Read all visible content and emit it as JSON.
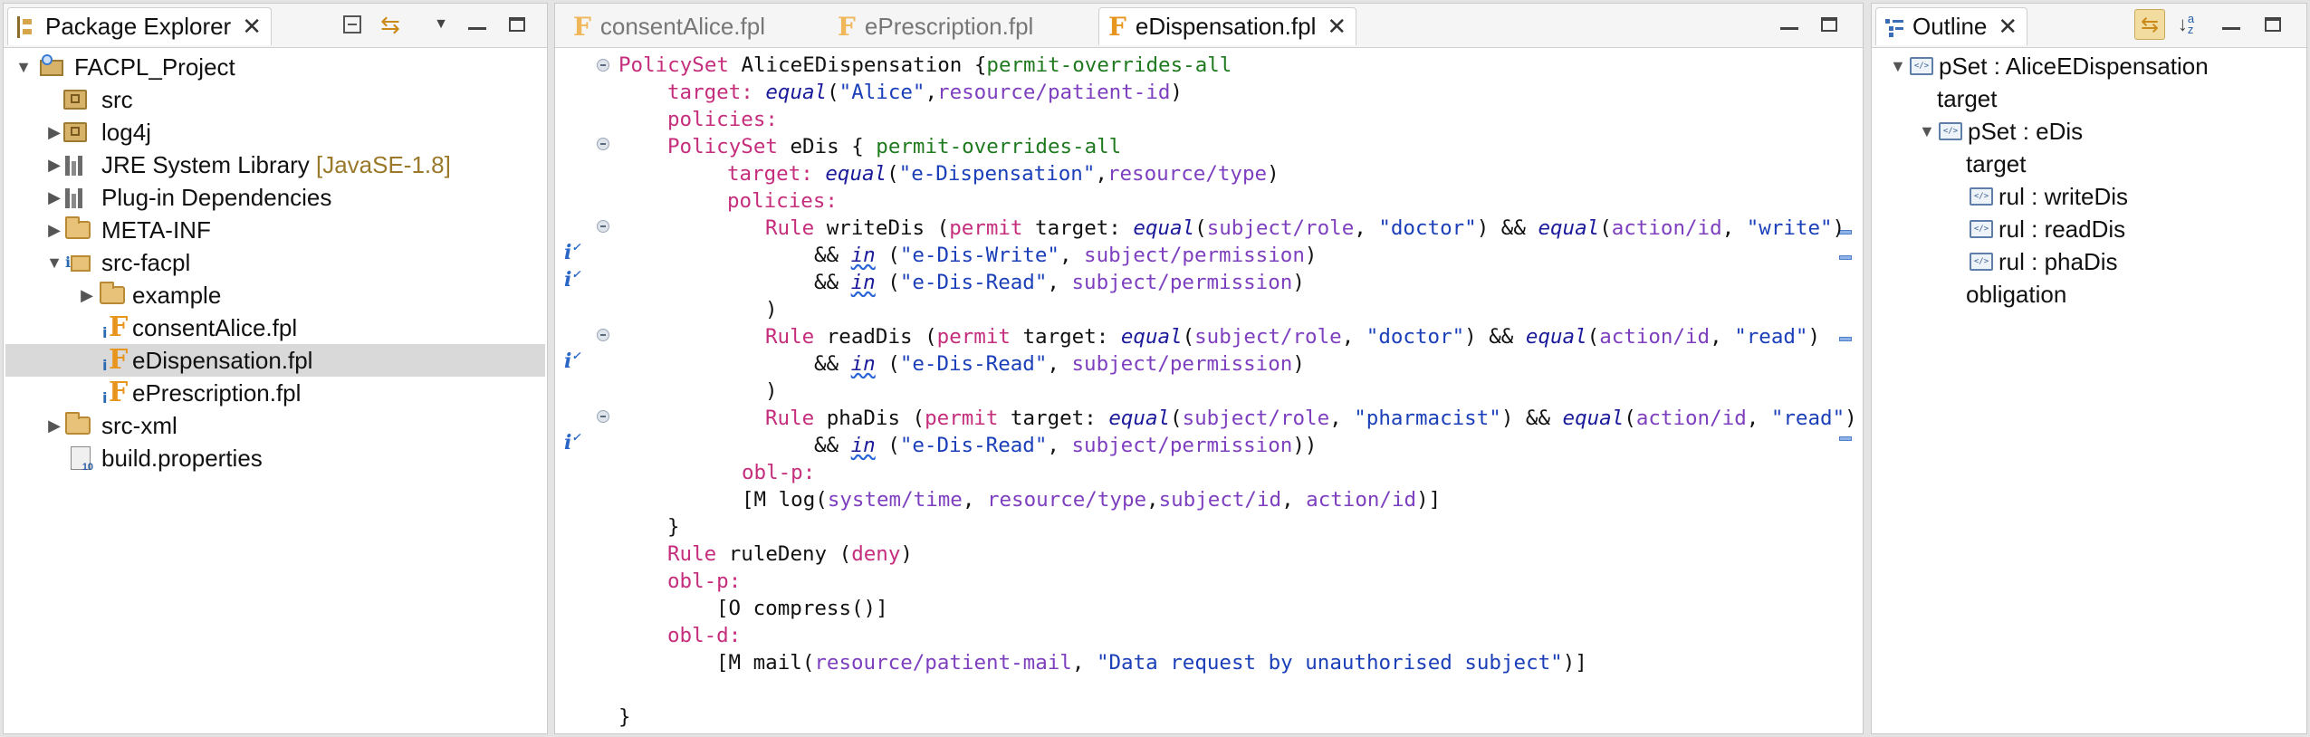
{
  "package_explorer": {
    "title": "Package Explorer",
    "tree": [
      {
        "label": "FACPL_Project",
        "decoration": "",
        "icon": "project-icon",
        "expanded": true
      },
      {
        "label": "src",
        "decoration": "",
        "icon": "package-folder-icon"
      },
      {
        "label": "log4j",
        "decoration": "",
        "icon": "package-folder-icon",
        "expanded": false
      },
      {
        "label": "JRE System Library",
        "decoration": "[JavaSE-1.8]",
        "icon": "library-icon",
        "expanded": false
      },
      {
        "label": "Plug-in Dependencies",
        "decoration": "",
        "icon": "library-icon",
        "expanded": false
      },
      {
        "label": "META-INF",
        "decoration": "",
        "icon": "folder-icon",
        "expanded": false
      },
      {
        "label": "src-facpl",
        "decoration": "",
        "icon": "source-package-icon",
        "expanded": true
      },
      {
        "label": "example",
        "decoration": "",
        "icon": "folder-icon",
        "expanded": false
      },
      {
        "label": "consentAlice.fpl",
        "decoration": "",
        "icon": "fpl-file-icon"
      },
      {
        "label": "eDispensation.fpl",
        "decoration": "",
        "icon": "fpl-file-icon",
        "selected": true
      },
      {
        "label": "ePrescription.fpl",
        "decoration": "",
        "icon": "fpl-file-icon"
      },
      {
        "label": "src-xml",
        "decoration": "",
        "icon": "folder-icon",
        "expanded": false
      },
      {
        "label": "build.properties",
        "decoration": "",
        "icon": "properties-file-icon"
      }
    ]
  },
  "editor": {
    "tabs": [
      {
        "label": "consentAlice.fpl",
        "active": false
      },
      {
        "label": "ePrescription.fpl",
        "active": false
      },
      {
        "label": "eDispensation.fpl",
        "active": true
      }
    ],
    "code": {
      "l1": {
        "a": "PolicySet",
        "b": " AliceEDispensation {",
        "c": "permit-overrides-all"
      },
      "l2": {
        "a": "target:",
        "b": " ",
        "c": "equal",
        "d": "(",
        "e": "\"Alice\"",
        "f": ",",
        "g": "resource/patient-id",
        "h": ")"
      },
      "l3": {
        "a": "policies:"
      },
      "l4": {
        "a": "PolicySet",
        "b": " eDis { ",
        "c": "permit-overrides-all"
      },
      "l5": {
        "a": "target:",
        "b": " ",
        "c": "equal",
        "d": "(",
        "e": "\"e-Dispensation\"",
        "f": ",",
        "g": "resource/type",
        "h": ")"
      },
      "l6": {
        "a": "policies:"
      },
      "l7": {
        "a": "Rule",
        "b": " writeDis (",
        "c": "permit",
        "d": " target: ",
        "e": "equal",
        "f": "(",
        "g": "subject/role",
        "h": ", ",
        "i": "\"doctor\"",
        "j": ") && ",
        "k": "equal",
        "l": "(",
        "m": "action/id",
        "n": ", ",
        "o": "\"write\"",
        "p": ")"
      },
      "l8": {
        "a": "&& ",
        "b": "in",
        "c": " (",
        "d": "\"e-Dis-Write\"",
        "e": ", ",
        "f": "subject/permission",
        "g": ")"
      },
      "l9": {
        "a": "&& ",
        "b": "in",
        "c": " (",
        "d": "\"e-Dis-Read\"",
        "e": ", ",
        "f": "subject/permission",
        "g": ")"
      },
      "l10": {
        "a": ")"
      },
      "l11": {
        "a": "Rule",
        "b": " readDis (",
        "c": "permit",
        "d": " target: ",
        "e": "equal",
        "f": "(",
        "g": "subject/role",
        "h": ", ",
        "i": "\"doctor\"",
        "j": ") && ",
        "k": "equal",
        "l": "(",
        "m": "action/id",
        "n": ", ",
        "o": "\"read\"",
        "p": ")"
      },
      "l12": {
        "a": "&& ",
        "b": "in",
        "c": " (",
        "d": "\"e-Dis-Read\"",
        "e": ", ",
        "f": "subject/permission",
        "g": ")"
      },
      "l13": {
        "a": ")"
      },
      "l14": {
        "a": "Rule",
        "b": " phaDis (",
        "c": "permit",
        "d": " target: ",
        "e": "equal",
        "f": "(",
        "g": "subject/role",
        "h": ", ",
        "i": "\"pharmacist\"",
        "j": ") && ",
        "k": "equal",
        "l": "(",
        "m": "action/id",
        "n": ", ",
        "o": "\"read\"",
        "p": ")"
      },
      "l15": {
        "a": "&& ",
        "b": "in",
        "c": " (",
        "d": "\"e-Dis-Read\"",
        "e": ", ",
        "f": "subject/permission",
        "g": "))"
      },
      "l16": {
        "a": "obl-p:"
      },
      "l17": {
        "a": "[M log(",
        "b": "system/time",
        "c": ", ",
        "d": "resource/type",
        "e": ",",
        "f": "subject/id",
        "g": ", ",
        "h": "action/id",
        "i": ")]"
      },
      "l18": {
        "a": "}"
      },
      "l19": {
        "a": "Rule",
        "b": " ruleDeny (",
        "c": "deny",
        "d": ")"
      },
      "l20": {
        "a": "obl-p:"
      },
      "l21": {
        "a": "[O compress()]"
      },
      "l22": {
        "a": "obl-d:"
      },
      "l23": {
        "a": "[M mail(",
        "b": "resource/patient-mail",
        "c": ", ",
        "d": "\"Data request by unauthorised subject\"",
        "e": ")]"
      },
      "l24": {
        "a": "}"
      }
    }
  },
  "outline": {
    "title": "Outline",
    "items": [
      {
        "label": "pSet : AliceEDispensation",
        "icon": "policy-set-icon"
      },
      {
        "label": "target"
      },
      {
        "label": "pSet : eDis",
        "icon": "policy-set-icon"
      },
      {
        "label": "target"
      },
      {
        "label": "rul : writeDis",
        "icon": "rule-icon"
      },
      {
        "label": "rul : readDis",
        "icon": "rule-icon"
      },
      {
        "label": "rul : phaDis",
        "icon": "rule-icon"
      },
      {
        "label": "obligation"
      }
    ]
  },
  "colors": {
    "keyword": "#c52d7d",
    "algorithm": "#1f7a1f",
    "function": "#1a1a9a",
    "string": "#1a3fb8",
    "attribute": "#7e3fbf",
    "selection": "#d9d9d9",
    "file_icon": "#e8951e"
  }
}
